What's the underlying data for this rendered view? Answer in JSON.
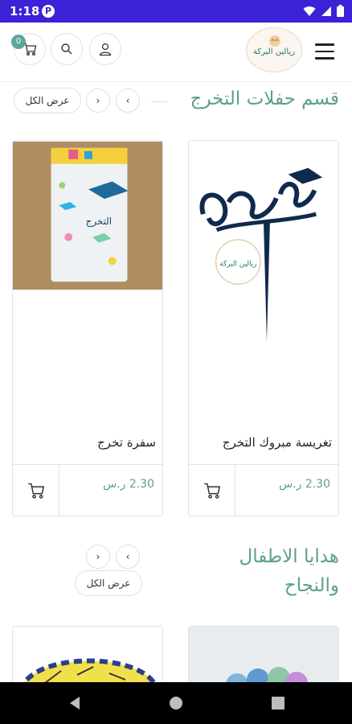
{
  "status_bar": {
    "time": "1:18"
  },
  "header": {
    "cart_count": "0",
    "logo_text": "ريالين البركة"
  },
  "section1": {
    "title": "قسم حفلات التخرج",
    "view_all": "عرض الكل",
    "products": [
      {
        "name": "تغريسة مبروك التخرج",
        "price": "2.30 ر.س"
      },
      {
        "name": "سفرة تخرج",
        "price": "2.30 ر.س"
      }
    ]
  },
  "section2": {
    "title_line1": "هدايا الاطفال",
    "title_line2": "والنجاح",
    "view_all": "عرض الكل"
  },
  "colors": {
    "status_bar": "#3c22d6",
    "accent": "#5e9e91",
    "badge": "#5aa89b"
  }
}
